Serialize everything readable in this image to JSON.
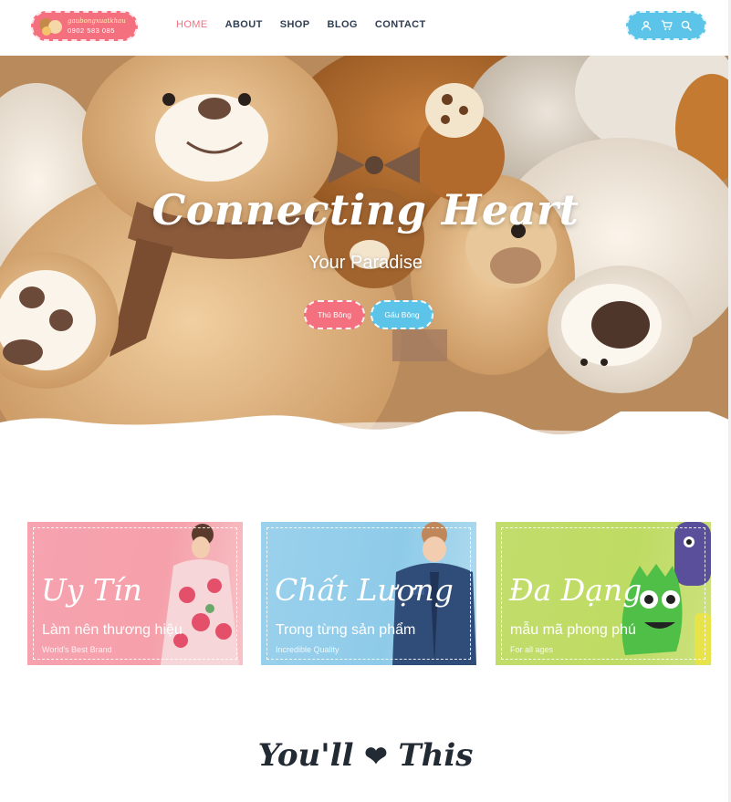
{
  "header": {
    "logo": {
      "name": "gaubongxuatkhau",
      "phone": "0902 583 085"
    },
    "nav": [
      {
        "label": "HOME",
        "active": true
      },
      {
        "label": "ABOUT",
        "active": false
      },
      {
        "label": "SHOP",
        "active": false
      },
      {
        "label": "BLOG",
        "active": false
      },
      {
        "label": "CONTACT",
        "active": false
      }
    ],
    "icons": [
      "user-icon",
      "cart-icon",
      "search-icon"
    ]
  },
  "hero": {
    "title": "Connecting Heart",
    "subtitle": "Your Paradise",
    "buttons": [
      {
        "label": "Thú Bông",
        "color": "#f4707f"
      },
      {
        "label": "Gấu Bông",
        "color": "#5bc4e8"
      }
    ]
  },
  "features": [
    {
      "script": "Uy Tín",
      "line": "Làm nên thương hiệu",
      "small": "World's Best Brand",
      "color": "#f5a0aa"
    },
    {
      "script": "Chất Lượng",
      "line": "Trong từng sản phẩm",
      "small": "Incredible Quality",
      "color": "#8ecbe9"
    },
    {
      "script": "Đa Dạng",
      "line": "mẫu mã phong phú",
      "small": "For all ages",
      "color": "#bedb63"
    }
  ],
  "section": {
    "title": "You'll",
    "heart": "❤",
    "title_end": "This"
  },
  "colors": {
    "accent_pink": "#f4707f",
    "accent_blue": "#5bc4e8",
    "text_dark": "#2f3e52"
  }
}
